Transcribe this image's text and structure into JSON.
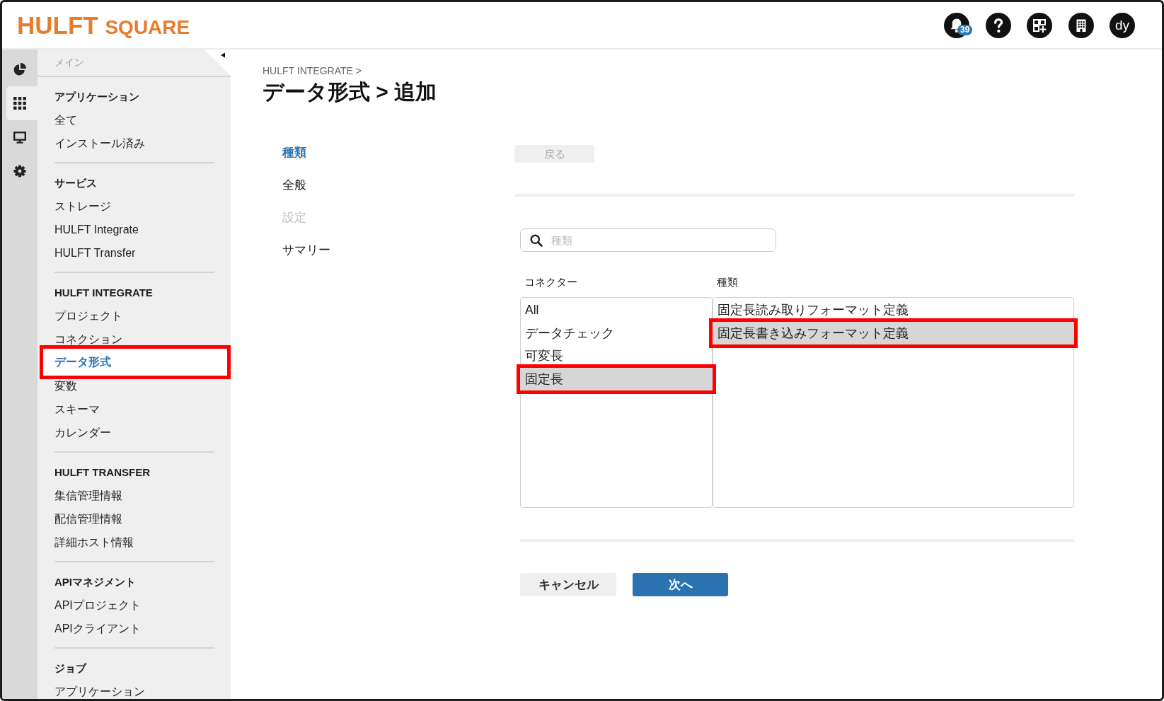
{
  "header": {
    "logo": {
      "primary": "HULFT",
      "secondary": "SQUARE"
    },
    "notifications": {
      "count": "39"
    },
    "user": {
      "initials": "dy"
    }
  },
  "icon_rail": [
    {
      "kind": "chart",
      "selected": false
    },
    {
      "kind": "apps",
      "selected": true
    },
    {
      "kind": "monitor",
      "selected": false
    },
    {
      "kind": "settings",
      "selected": false
    }
  ],
  "sidebar": {
    "heading": "メイン",
    "sections": [
      {
        "title": "アプリケーション",
        "items": [
          {
            "label": "全て",
            "selected": false,
            "highlighted": false
          },
          {
            "label": "インストール済み",
            "selected": false,
            "highlighted": false
          }
        ]
      },
      {
        "title": "サービス",
        "items": [
          {
            "label": "ストレージ",
            "selected": false,
            "highlighted": false
          },
          {
            "label": "HULFT Integrate",
            "selected": false,
            "highlighted": false
          },
          {
            "label": "HULFT Transfer",
            "selected": false,
            "highlighted": false
          }
        ]
      },
      {
        "title": "HULFT INTEGRATE",
        "items": [
          {
            "label": "プロジェクト",
            "selected": false,
            "highlighted": false
          },
          {
            "label": "コネクション",
            "selected": false,
            "highlighted": false
          },
          {
            "label": "データ形式",
            "selected": true,
            "highlighted": true
          },
          {
            "label": "変数",
            "selected": false,
            "highlighted": false
          },
          {
            "label": "スキーマ",
            "selected": false,
            "highlighted": false
          },
          {
            "label": "カレンダー",
            "selected": false,
            "highlighted": false
          }
        ]
      },
      {
        "title": "HULFT TRANSFER",
        "items": [
          {
            "label": "集信管理情報",
            "selected": false,
            "highlighted": false
          },
          {
            "label": "配信管理情報",
            "selected": false,
            "highlighted": false
          },
          {
            "label": "詳細ホスト情報",
            "selected": false,
            "highlighted": false
          }
        ]
      },
      {
        "title": "APIマネジメント",
        "items": [
          {
            "label": "APIプロジェクト",
            "selected": false,
            "highlighted": false
          },
          {
            "label": "APIクライアント",
            "selected": false,
            "highlighted": false
          }
        ]
      },
      {
        "title": "ジョブ",
        "items": [
          {
            "label": "アプリケーション",
            "selected": false,
            "highlighted": false
          }
        ]
      }
    ]
  },
  "breadcrumb": "HULFT INTEGRATE >",
  "page_title": "データ形式 > 追加",
  "steps": [
    {
      "label": "種類",
      "selected": true,
      "disabled": false
    },
    {
      "label": "全般",
      "selected": false,
      "disabled": false
    },
    {
      "label": "設定",
      "selected": false,
      "disabled": true
    },
    {
      "label": "サマリー",
      "selected": false,
      "disabled": false
    }
  ],
  "back_button": {
    "label": "戻る",
    "disabled": true
  },
  "search": {
    "placeholder": "種類"
  },
  "connectors": {
    "heading": "コネクター",
    "items": [
      {
        "label": "All",
        "selected": false,
        "highlighted": false
      },
      {
        "label": "データチェック",
        "selected": false,
        "highlighted": false
      },
      {
        "label": "可変長",
        "selected": false,
        "highlighted": false
      },
      {
        "label": "固定長",
        "selected": true,
        "highlighted": true
      }
    ]
  },
  "types": {
    "heading": "種類",
    "items": [
      {
        "label": "固定長読み取りフォーマット定義",
        "selected": false,
        "highlighted": false
      },
      {
        "label": "固定長書き込みフォーマット定義",
        "selected": true,
        "highlighted": true
      }
    ]
  },
  "actions": [
    {
      "label": "キャンセル",
      "kind": "secondary"
    },
    {
      "label": "次へ",
      "kind": "primary"
    }
  ]
}
